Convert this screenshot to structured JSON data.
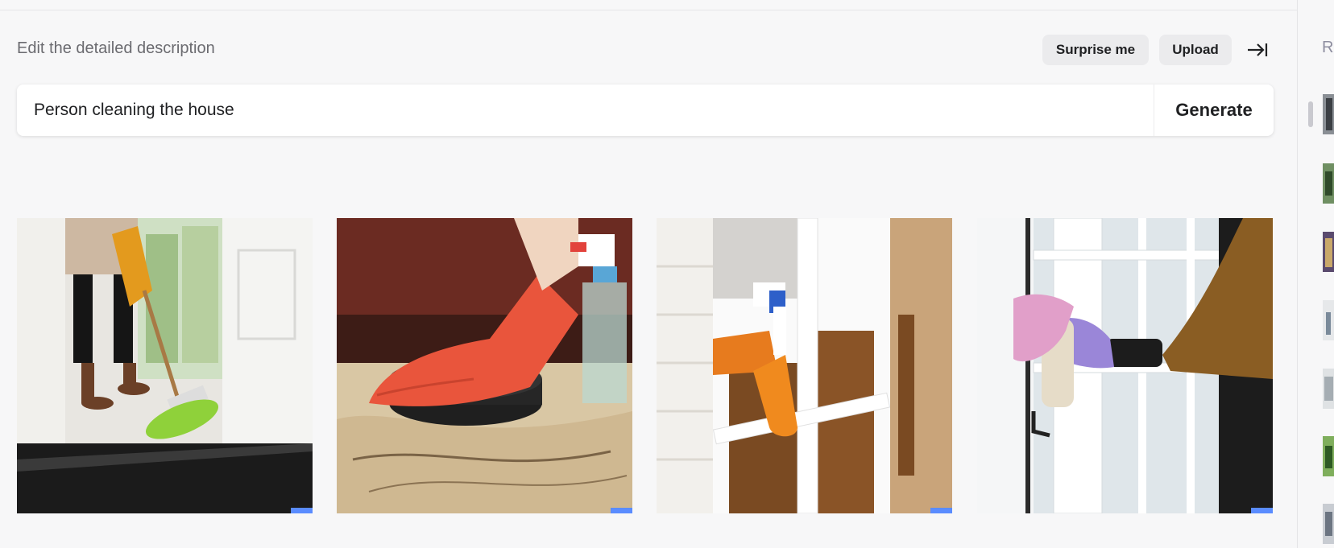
{
  "header": {
    "title": "Edit the detailed description",
    "surprise_label": "Surprise me",
    "upload_label": "Upload"
  },
  "prompt": {
    "value": "Person cleaning the house",
    "generate_label": "Generate"
  },
  "sidebar": {
    "label": "R"
  },
  "colors": {
    "background": "#f7f7f8",
    "pill": "#ebebed",
    "text": "#202123",
    "muted": "#6b6b70"
  },
  "icons": [
    "collapse-arrow-icon"
  ],
  "images": [
    {
      "name": "broom-sweeping"
    },
    {
      "name": "red-glove-sponge"
    },
    {
      "name": "orange-spray-bottle-window"
    },
    {
      "name": "purple-glove-door-cleaning"
    }
  ]
}
